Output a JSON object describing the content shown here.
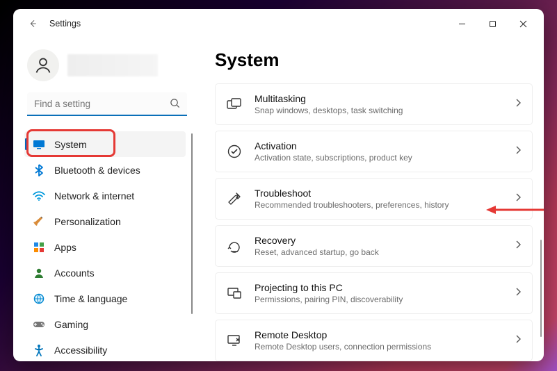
{
  "window": {
    "title": "Settings"
  },
  "search": {
    "placeholder": "Find a setting"
  },
  "sidebar": {
    "items": [
      {
        "label": "System"
      },
      {
        "label": "Bluetooth & devices"
      },
      {
        "label": "Network & internet"
      },
      {
        "label": "Personalization"
      },
      {
        "label": "Apps"
      },
      {
        "label": "Accounts"
      },
      {
        "label": "Time & language"
      },
      {
        "label": "Gaming"
      },
      {
        "label": "Accessibility"
      }
    ]
  },
  "page": {
    "title": "System"
  },
  "cards": [
    {
      "title": "Multitasking",
      "sub": "Snap windows, desktops, task switching"
    },
    {
      "title": "Activation",
      "sub": "Activation state, subscriptions, product key"
    },
    {
      "title": "Troubleshoot",
      "sub": "Recommended troubleshooters, preferences, history"
    },
    {
      "title": "Recovery",
      "sub": "Reset, advanced startup, go back"
    },
    {
      "title": "Projecting to this PC",
      "sub": "Permissions, pairing PIN, discoverability"
    },
    {
      "title": "Remote Desktop",
      "sub": "Remote Desktop users, connection permissions"
    }
  ]
}
